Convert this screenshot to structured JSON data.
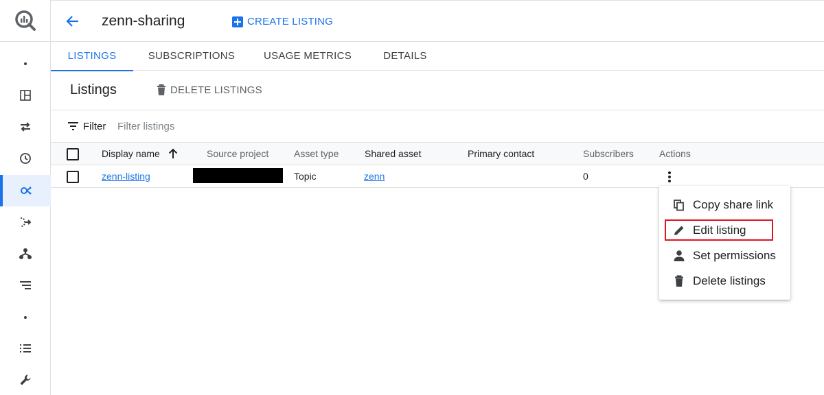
{
  "header": {
    "title": "zenn-sharing",
    "create_label": "CREATE LISTING"
  },
  "tabs": [
    {
      "label": "LISTINGS",
      "active": true
    },
    {
      "label": "SUBSCRIPTIONS",
      "active": false
    },
    {
      "label": "USAGE METRICS",
      "active": false
    },
    {
      "label": "DETAILS",
      "active": false
    }
  ],
  "section": {
    "title": "Listings",
    "delete_label": "DELETE LISTINGS"
  },
  "filter": {
    "label": "Filter",
    "placeholder": "Filter listings"
  },
  "table": {
    "columns": [
      "Display name",
      "Source project",
      "Asset type",
      "Shared asset",
      "Primary contact",
      "Subscribers",
      "Actions"
    ],
    "sort_column": "Display name",
    "rows": [
      {
        "display_name": "zenn-listing",
        "asset_type": "Topic",
        "shared_asset": "zenn",
        "primary_contact": "",
        "subscribers": "0"
      }
    ]
  },
  "menu": {
    "items": [
      {
        "label": "Copy share link",
        "icon": "copy-icon"
      },
      {
        "label": "Edit listing",
        "icon": "pencil-icon",
        "highlighted": true
      },
      {
        "label": "Set permissions",
        "icon": "person-icon"
      },
      {
        "label": "Delete listings",
        "icon": "trash-icon"
      }
    ]
  },
  "colors": {
    "accent": "#1a73e8",
    "highlight_border": "#e0141e",
    "text": "#202124",
    "muted": "#5f6368"
  }
}
